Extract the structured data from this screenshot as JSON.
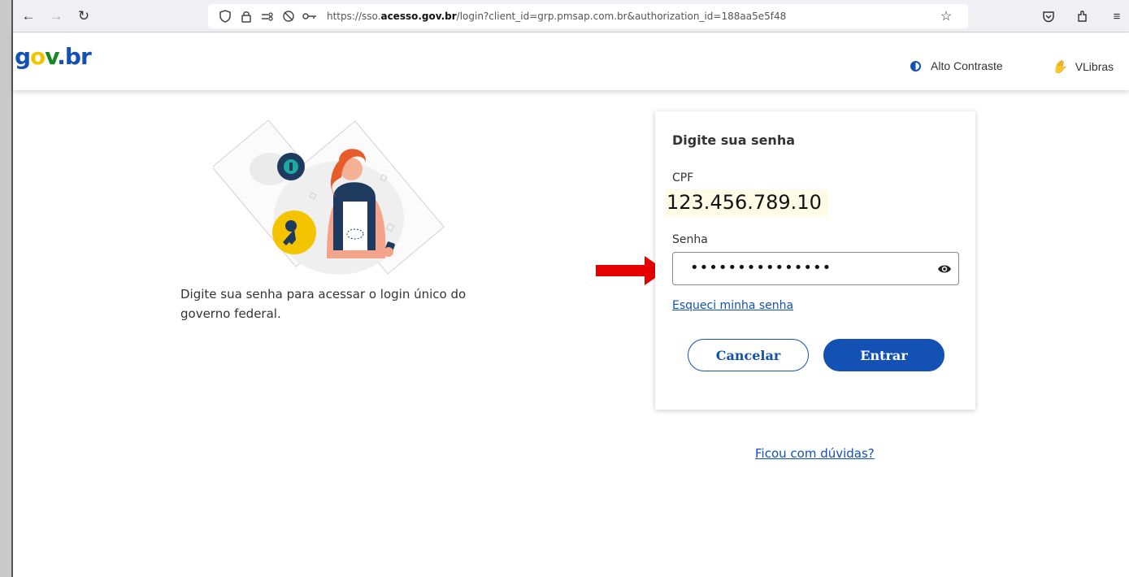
{
  "browser": {
    "url_prefix": "https://sso.",
    "url_domain": "acesso.gov.br",
    "url_path": "/login?client_id=grp.pmsap.com.br&authorization_id=188aa5e5f48"
  },
  "header": {
    "logo_g": "g",
    "logo_o": "o",
    "logo_v": "v",
    "logo_br": ".br",
    "contrast_label": "Alto Contraste",
    "libras_label": "VLibras"
  },
  "intro": {
    "text": "Digite sua senha para acessar o login único do governo federal."
  },
  "login": {
    "title": "Digite sua senha",
    "cpf_label": "CPF",
    "cpf_value": "123.456.789.10",
    "password_label": "Senha",
    "password_masked": "•••••••••••••••",
    "forgot_link": "Esqueci minha senha",
    "cancel_button": "Cancelar",
    "submit_button": "Entrar"
  },
  "help": {
    "link": "Ficou com dúvidas?"
  },
  "colors": {
    "primary": "#1351b4",
    "annotation_arrow": "#e60000"
  }
}
